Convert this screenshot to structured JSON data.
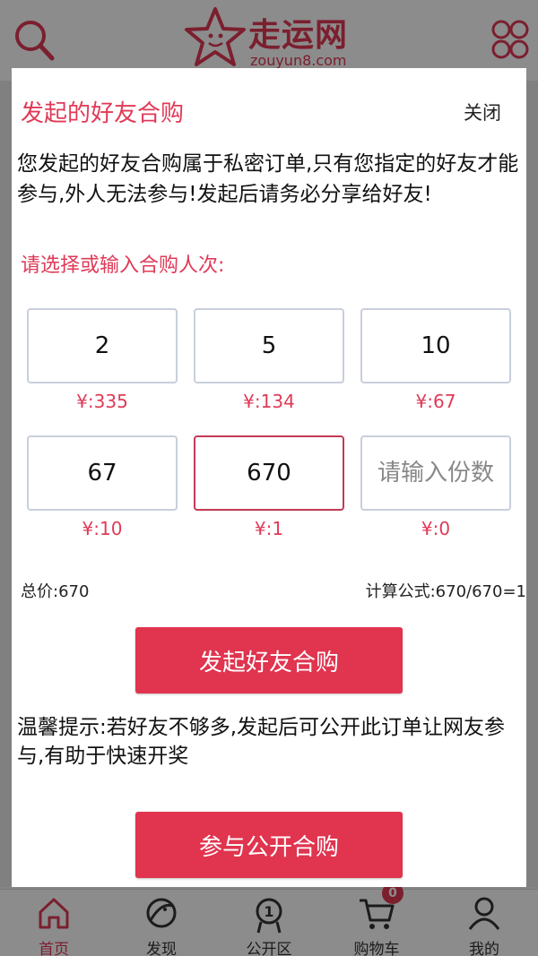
{
  "header": {
    "logo_title": "走运网",
    "logo_url": "zouyun8.com"
  },
  "dialog": {
    "title": "发起的好友合购",
    "close_label": "关闭",
    "description": "您发起的好友合购属于私密订单,只有您指定的好友才能参与,外人无法参与!发起后请务必分享给好友!",
    "prompt": "请选择或输入合购人次:",
    "options": [
      {
        "value": "2",
        "price": "¥:335"
      },
      {
        "value": "5",
        "price": "¥:134"
      },
      {
        "value": "10",
        "price": "¥:67"
      },
      {
        "value": "67",
        "price": "¥:10"
      },
      {
        "value": "670",
        "price": "¥:1",
        "selected": true
      }
    ],
    "custom_input": {
      "placeholder": "请输入份数",
      "price": "¥:0"
    },
    "total_label": "总价:670",
    "formula_label": "计算公式:670/670=1",
    "start_button": "发起好友合购",
    "tip": "温馨提示:若好友不够多,发起后可公开此订单让网友参与,有助于快速开奖",
    "public_button": "参与公开合购"
  },
  "tabbar": {
    "items": [
      {
        "label": "首页",
        "icon": "home-icon",
        "active": true
      },
      {
        "label": "发现",
        "icon": "planet-icon"
      },
      {
        "label": "公开区",
        "icon": "medal-icon"
      },
      {
        "label": "购物车",
        "icon": "cart-icon",
        "badge": "0"
      },
      {
        "label": "我的",
        "icon": "user-icon"
      }
    ]
  },
  "colors": {
    "accent": "#e03a57",
    "button": "#e0344f",
    "selected_border": "#c33a55",
    "option_border": "#c8cfdb"
  }
}
